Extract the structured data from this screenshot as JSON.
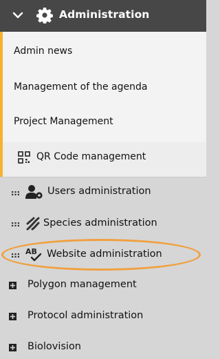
{
  "header": {
    "title": "Administration",
    "chevron_icon": "chevron-down-icon",
    "main_icon": "gear-icon"
  },
  "submenu": [
    {
      "label": "Admin news"
    },
    {
      "label": "Management of the agenda"
    },
    {
      "label": "Project Management"
    },
    {
      "label": "QR Code management",
      "icon": "qr-code-icon"
    }
  ],
  "menu": [
    {
      "label": "Users administration",
      "icon": "users-gear-icon"
    },
    {
      "label": "Species administration",
      "icon": "dna-icon"
    },
    {
      "label": "Website administration",
      "icon": "spellcheck-icon",
      "highlighted": true
    },
    {
      "label": "Polygon management",
      "icon": "plus-square-icon"
    },
    {
      "label": "Protocol administration",
      "icon": "plus-square-icon"
    },
    {
      "label": "Biolovision",
      "icon": "plus-square-icon"
    }
  ],
  "colors": {
    "header_bg": "#474747",
    "accent": "#f5b22f",
    "highlight_ring": "#f0a040",
    "menu_bg": "#d6d6d6"
  }
}
